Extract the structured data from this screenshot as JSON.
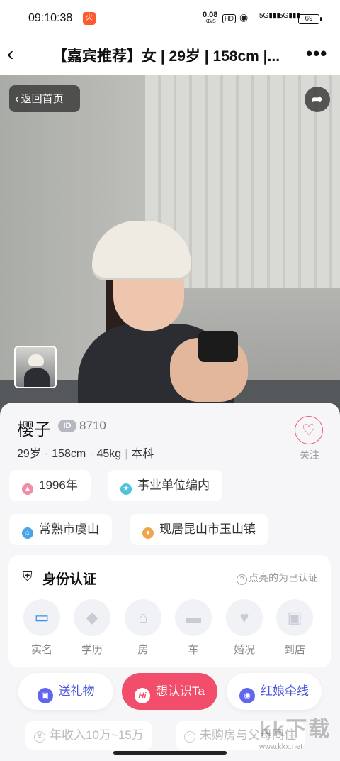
{
  "status_bar": {
    "time": "09:10:38",
    "app_badge": "火",
    "net_speed_value": "0.08",
    "net_speed_unit": "KB/S",
    "hd_label": "HD",
    "signal_1": "5G",
    "signal_2": "5G",
    "battery": "69"
  },
  "nav": {
    "title": "【嘉宾推荐】女 | 29岁 | 158cm |...",
    "back_icon": "back-arrow-icon",
    "more_icon": "more-dots-icon"
  },
  "photo": {
    "home_button_label": "返回首页",
    "share_icon": "share-icon"
  },
  "profile": {
    "name": "樱子",
    "id_badge": "ID",
    "id_number": "8710",
    "age": "29岁",
    "height": "158cm",
    "weight": "45kg",
    "education": "本科",
    "follow_label": "关注",
    "tags": [
      {
        "label": "1996年",
        "icon": "cake-icon",
        "color": "#f08ca4"
      },
      {
        "label": "事业单位编内",
        "icon": "badge-icon",
        "color": "#4fc3d9"
      },
      {
        "label": "常熟市虞山",
        "icon": "home-icon",
        "color": "#4aa3e6"
      },
      {
        "label": "现居昆山市玉山镇",
        "icon": "location-icon",
        "color": "#f0a54a"
      }
    ]
  },
  "identity": {
    "title": "身份认证",
    "hint": "点亮的为已认证",
    "items": [
      {
        "label": "实名",
        "icon": "id-card-icon",
        "verified": true
      },
      {
        "label": "学历",
        "icon": "graduation-cap-icon",
        "verified": false
      },
      {
        "label": "房",
        "icon": "house-icon",
        "verified": false
      },
      {
        "label": "车",
        "icon": "car-icon",
        "verified": false
      },
      {
        "label": "婚况",
        "icon": "marriage-doc-icon",
        "verified": false
      },
      {
        "label": "到店",
        "icon": "store-icon",
        "verified": false
      }
    ]
  },
  "actions": {
    "gift": "送礼物",
    "hi_icon": "Hi",
    "hi": "想认识Ta",
    "matchmaker": "红娘牵线"
  },
  "more": {
    "income": "年收入10万~15万",
    "housing": "未购房与父母同住"
  },
  "watermark": {
    "text": "kk下载",
    "url": "www.kkx.net"
  },
  "colors": {
    "accent_pink": "#f24d6b",
    "accent_blue": "#4a56e0"
  }
}
